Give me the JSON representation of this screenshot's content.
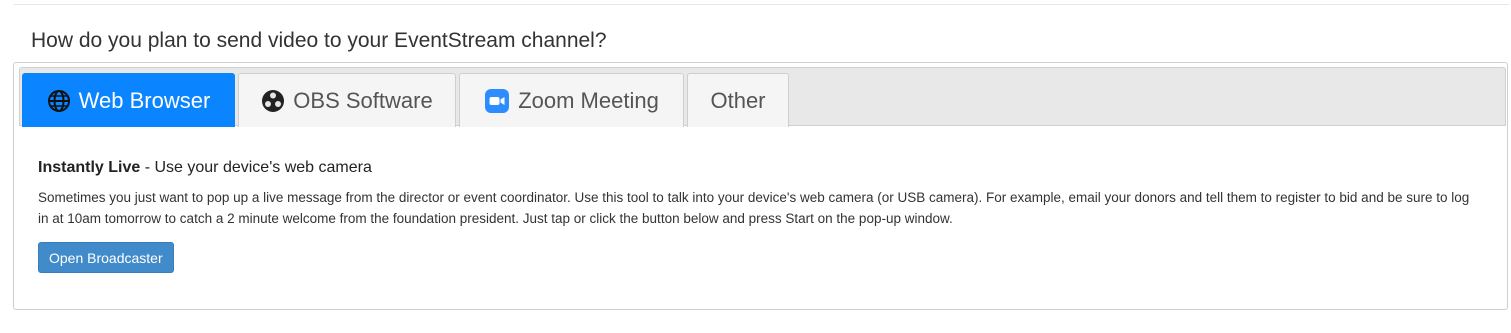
{
  "question": "How do you plan to send video to your EventStream channel?",
  "tabs": [
    {
      "label": "Web Browser",
      "icon": "globe-icon",
      "active": true
    },
    {
      "label": "OBS Software",
      "icon": "obs-icon",
      "active": false
    },
    {
      "label": "Zoom Meeting",
      "icon": "zoom-icon",
      "active": false
    },
    {
      "label": "Other",
      "icon": "",
      "active": false
    }
  ],
  "content": {
    "title": "Instantly Live",
    "subtitle": " - Use your device's web camera",
    "description": "Sometimes you just want to pop up a live message from the director or event coordinator. Use this tool to talk into your device's web camera (or USB camera). For example, email your donors and tell them to register to bid and be sure to log in at 10am tomorrow to catch a 2 minute welcome from the foundation president. Just tap or click the button below and press Start on the pop-up window.",
    "button_label": "Open Broadcaster"
  },
  "colors": {
    "active_tab": "#0a84ff",
    "button": "#428bca",
    "zoom_brand": "#2d8cff"
  }
}
